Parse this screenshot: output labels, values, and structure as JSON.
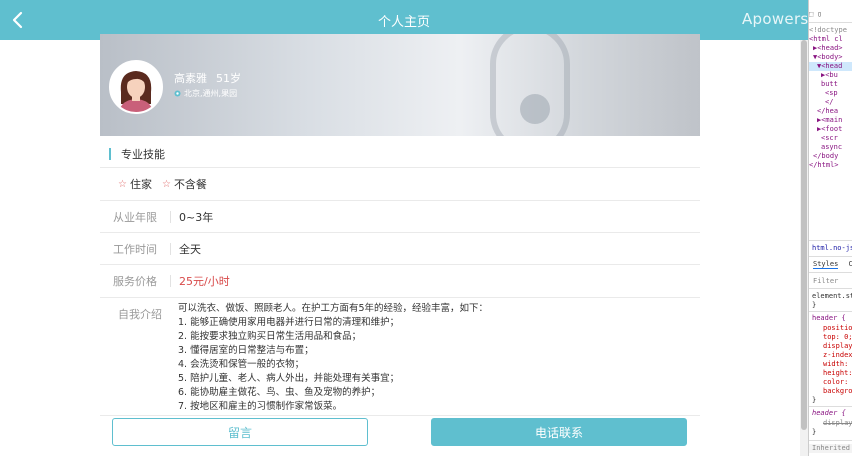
{
  "header": {
    "title": "个人主页",
    "back_icon": "chevron-left-icon",
    "bg_color": "#5fbfcf"
  },
  "watermark": "Apowersoft",
  "profile": {
    "name": "高素雅",
    "age": "51岁",
    "location": "北京,通州,果园"
  },
  "skills": {
    "heading": "专业技能",
    "tags": [
      "住家",
      "不含餐"
    ]
  },
  "details": [
    {
      "label": "从业年限",
      "value": "0~3年"
    },
    {
      "label": "工作时间",
      "value": "全天"
    },
    {
      "label": "服务价格",
      "value": "25元/小时"
    }
  ],
  "intro": {
    "label": "自我介绍",
    "lines": [
      "可以洗衣、做饭、照顾老人。在护工方面有5年的经验，经验丰富，如下：",
      "1. 能够正确使用家用电器并进行日常的清理和维护；",
      "2. 能按要求独立购买日常生活用品和食品；",
      "3. 懂得居室的日常整洁与布置；",
      "4. 会洗烫和保管一般的衣物；",
      "5. 陪护儿童、老人、病人外出，并能处理有关事宜；",
      "6. 能协助雇主做花、鸟、虫、鱼及宠物的养护；",
      "7. 按地区和雇主的习惯制作家常饭菜。"
    ]
  },
  "actions": {
    "message_label": "留言",
    "call_label": "电话联系"
  },
  "devtools": {
    "lines": [
      "<!doctype",
      "<html cl",
      "▶<head>",
      "▼<body>",
      "▼<head",
      "▶<bu",
      "butt",
      "<sp",
      "</",
      "</hea",
      "▶<main",
      "▶<foot",
      "<scr",
      "async",
      "</body",
      "</html>"
    ],
    "breadcrumb": "html.no-js",
    "tabs": [
      "Styles",
      "C"
    ],
    "filter_placeholder": "Filter",
    "css_lines": [
      "element.st",
      "}",
      "header {",
      "positio",
      "top: 0;",
      "display",
      "z-index",
      "width:",
      "height:",
      "color:",
      "backgro",
      "}",
      "header {",
      "display",
      "}"
    ],
    "inherited": "Inherited fro"
  }
}
